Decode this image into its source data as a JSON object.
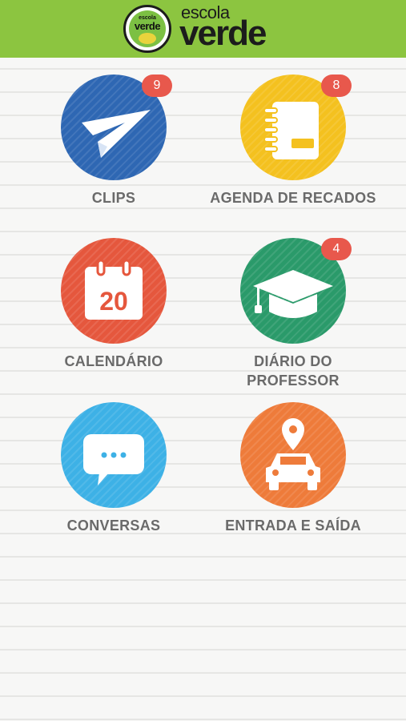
{
  "header": {
    "brand_small": "escola",
    "brand_main": "verde",
    "badge_line1": "escola",
    "badge_line2": "verde"
  },
  "tiles": [
    {
      "label": "CLIPS",
      "badge": "9",
      "color": "#2e67b3",
      "icon": "paper-plane-icon"
    },
    {
      "label": "AGENDA DE RECADOS",
      "badge": "8",
      "color": "#f4c11f",
      "icon": "notebook-icon"
    },
    {
      "label": "CALENDÁRIO",
      "badge": "",
      "color": "#e5573d",
      "icon": "calendar-icon",
      "icon_text": "20"
    },
    {
      "label": "DIÁRIO DO PROFESSOR",
      "badge": "4",
      "color": "#2a9a6a",
      "icon": "graduation-cap-icon"
    },
    {
      "label": "CONVERSAS",
      "badge": "",
      "color": "#3db1e6",
      "icon": "chat-bubble-icon"
    },
    {
      "label": "ENTRADA E SAÍDA",
      "badge": "",
      "color": "#ee7b3a",
      "icon": "car-location-icon"
    }
  ],
  "colors": {
    "header": "#8cc540",
    "badge": "#e8584c",
    "label": "#6a6a6a"
  }
}
